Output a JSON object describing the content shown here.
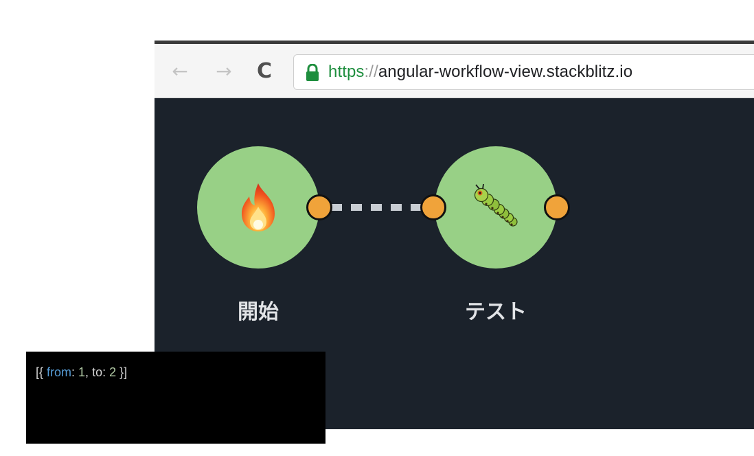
{
  "browser": {
    "nav": {
      "back_icon": "←",
      "forward_icon": "→",
      "reload_icon": "C"
    },
    "url": {
      "scheme": "https",
      "separator": "://",
      "host": "angular-workflow-view.stackblitz.io"
    }
  },
  "workflow": {
    "nodes": [
      {
        "id": 1,
        "icon": "fire-icon",
        "label": "開始"
      },
      {
        "id": 2,
        "icon": "caterpillar-icon",
        "label": "テスト"
      }
    ]
  },
  "output": {
    "open": "[{ ",
    "key_from": "from",
    "colon1": ": ",
    "value_from": "1",
    "comma": ", ",
    "key_to": "to",
    "colon2": ": ",
    "value_to": "2",
    "close": " }]"
  },
  "colors": {
    "canvas_bg": "#1b222b",
    "node_fill": "#98d086",
    "port_fill": "#f0a33a",
    "edge": "#c8cdd3",
    "url_scheme": "#1e8e3e"
  }
}
